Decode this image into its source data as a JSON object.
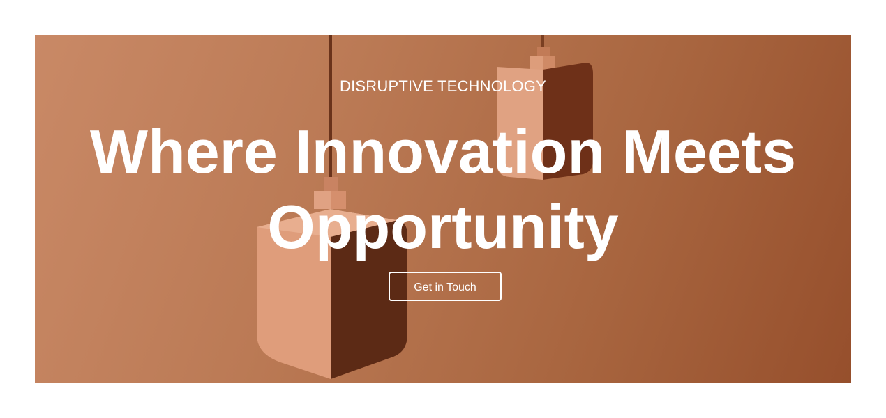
{
  "hero": {
    "eyebrow": "DISRUPTIVE TECHNOLOGY",
    "headline": "Where Innovation Meets Opportunity",
    "cta_label": "Get in Touch",
    "image_subject": "pendant-lamps-image"
  },
  "colors": {
    "page_background": "#ffffff",
    "hero_background": "#b4714c",
    "text": "#ffffff"
  }
}
